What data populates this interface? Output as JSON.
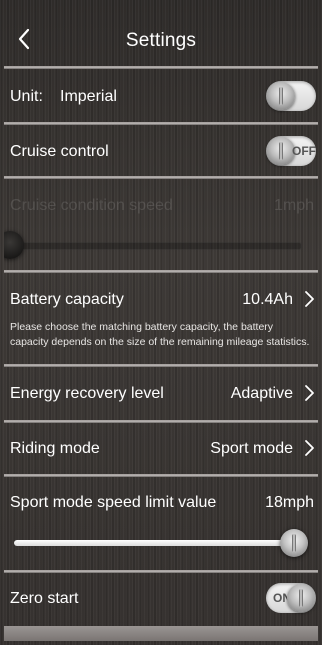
{
  "header": {
    "title": "Settings",
    "back_icon": "chevron-left-icon"
  },
  "unit": {
    "label": "Unit:",
    "value": "Imperial",
    "toggle_on": false
  },
  "cruise_control": {
    "label": "Cruise control",
    "state_text": "OFF",
    "toggle_on": false
  },
  "cruise_condition_speed": {
    "label": "Cruise condition speed",
    "value": "1mph",
    "slider_fraction": 0.0,
    "enabled": false
  },
  "battery_capacity": {
    "label": "Battery capacity",
    "value": "10.4Ah",
    "note": "Please choose the matching battery capacity, the battery capacity depends on the size of the remaining mileage statistics."
  },
  "energy_recovery": {
    "label": "Energy recovery level",
    "value": "Adaptive"
  },
  "riding_mode": {
    "label": "Riding mode",
    "value": "Sport mode"
  },
  "sport_speed_limit": {
    "label": "Sport mode speed limit value",
    "value": "18mph",
    "slider_fraction": 1.0
  },
  "zero_start": {
    "label": "Zero start",
    "state_text": "ON",
    "toggle_on": true
  },
  "colors": {
    "accent": "#ffffff",
    "separator": "#bdb9b7",
    "background": "#3a3634"
  }
}
